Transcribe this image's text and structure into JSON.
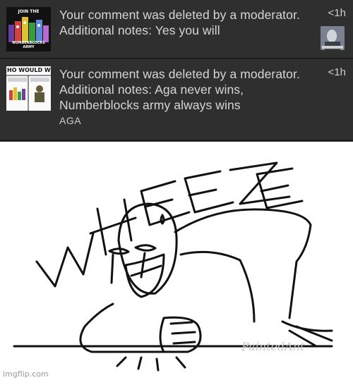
{
  "notifications": [
    {
      "message_line1": "Your comment was deleted by a moderator.",
      "message_line2": "Additional notes: Yes you will",
      "time": "<1h",
      "thumb_top_text": "JOIN THE",
      "thumb_bottom_text": "NUMBERBLOCKS ARMY"
    },
    {
      "message_line1": "Your comment was deleted by a moderator.",
      "message_line2": "Additional notes: Aga never wins,",
      "message_line3": "Numberblocks army always wins",
      "author": "AGA",
      "time": "<1h",
      "thumb_top_text": "HO WOULD WI"
    }
  ],
  "meme": {
    "caption": "WHEEZE",
    "artist_signature": "PaintedAnt",
    "watermark": "imgflip.com"
  },
  "colors": {
    "panel_bg": "#2f2f2f",
    "text": "#d6d6d6",
    "divider": "#1c1c1c"
  }
}
